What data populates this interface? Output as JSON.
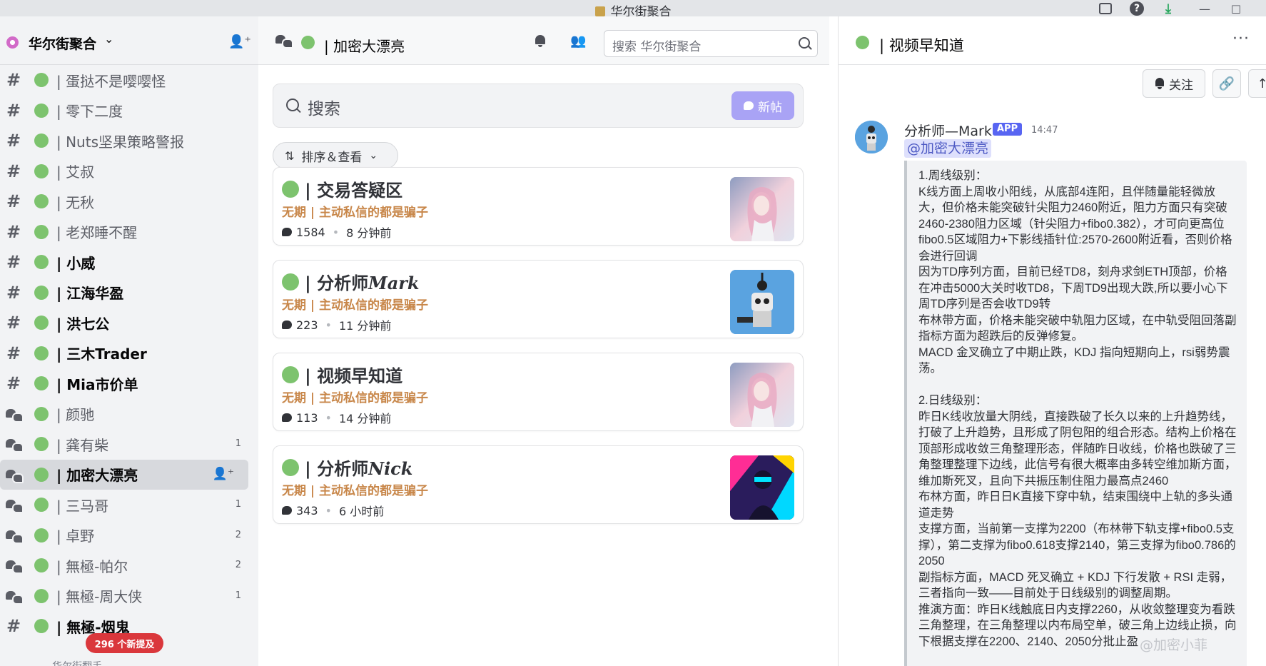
{
  "window": {
    "title": "华尔街聚合"
  },
  "sidebar": {
    "server_name": "华尔街聚合",
    "channels": [
      {
        "type": "text",
        "name": "| 蛋挞不是嘤嘤怪",
        "bold": false,
        "badge": ""
      },
      {
        "type": "text",
        "name": "| 零下二度",
        "bold": false,
        "badge": ""
      },
      {
        "type": "text",
        "name": "| Nuts坚果策略警报",
        "bold": false,
        "badge": ""
      },
      {
        "type": "text",
        "name": "| 艾叔",
        "bold": false,
        "badge": ""
      },
      {
        "type": "text",
        "name": "| 无秋",
        "bold": false,
        "badge": ""
      },
      {
        "type": "text",
        "name": "| 老郑睡不醒",
        "bold": false,
        "badge": ""
      },
      {
        "type": "text",
        "name": "| 小威",
        "bold": true,
        "badge": ""
      },
      {
        "type": "text",
        "name": "| 江海华盈",
        "bold": true,
        "badge": ""
      },
      {
        "type": "text",
        "name": "| 洪七公",
        "bold": true,
        "badge": ""
      },
      {
        "type": "text",
        "name": "| 三木Trader",
        "bold": true,
        "badge": ""
      },
      {
        "type": "text",
        "name": "| Mia市价单",
        "bold": true,
        "badge": ""
      },
      {
        "type": "forum",
        "name": "| 颜驰",
        "bold": false,
        "badge": ""
      },
      {
        "type": "forum",
        "name": "| 龚有柴",
        "bold": false,
        "badge": "1"
      },
      {
        "type": "forum",
        "name": "| 加密大漂亮",
        "bold": true,
        "badge": "",
        "active": true
      },
      {
        "type": "forum",
        "name": "| 三马哥",
        "bold": false,
        "badge": "1"
      },
      {
        "type": "forum",
        "name": "| 卓野",
        "bold": false,
        "badge": "2"
      },
      {
        "type": "forum",
        "name": "| 無極-帕尔",
        "bold": false,
        "badge": "2"
      },
      {
        "type": "forum",
        "name": "| 無極-周大侠",
        "bold": false,
        "badge": "1"
      },
      {
        "type": "text",
        "name": "| 無極-烟鬼",
        "bold": true,
        "badge": ""
      }
    ],
    "new_mentions": "296 个新提及",
    "bottom_category": "------------ 华尔街翻手 ------------"
  },
  "forum": {
    "title": "| 加密大漂亮",
    "search_placeholder": "搜索 华尔街聚合",
    "search_label": "搜索",
    "new_post_label": "新帖",
    "sort_label": "排序＆查看",
    "posts": [
      {
        "title_prefix": "| 交易答疑区",
        "title_italic": "",
        "tag": "无期 | 主动私信的都是骗子",
        "comments": "1584",
        "time": "8 分钟前",
        "thumb": "girl"
      },
      {
        "title_prefix": "| 分析师",
        "title_italic": "Mark",
        "tag": "无期 | 主动私信的都是骗子",
        "comments": "223",
        "time": "11 分钟前",
        "thumb": "robot"
      },
      {
        "title_prefix": "| 视频早知道",
        "title_italic": "",
        "tag": "无期 | 主动私信的都是骗子",
        "comments": "113",
        "time": "14 分钟前",
        "thumb": "girl"
      },
      {
        "title_prefix": "| 分析师",
        "title_italic": "Nick",
        "tag": "无期 | 主动私信的都是骗子",
        "comments": "343",
        "time": "6 小时前",
        "thumb": "neon"
      }
    ]
  },
  "thread": {
    "title": "| 视频早知道",
    "follow_label": "关注",
    "message": {
      "author": "分析师—Mark",
      "app_badge": "APP",
      "time": "14:47",
      "mention": "@加密大漂亮",
      "paragraphs": [
        "1.周线级别：",
        "K线方面上周收小阳线，从底部4连阳，且伴随量能轻微放大，但价格未能突破针尖阻力2460附近，阻力方面只有突破2460-2380阻力区域（针尖阻力+fibo0.382），才可向更高位fibo0.5区域阻力+下影线插针位:2570-2600附近看，否则价格会进行回调",
        "因为TD序列方面，目前已经TD8，刻舟求剑ETH顶部，价格在冲击5000大关时收TD8，下周TD9出现大跌,所以要小心下周TD序列是否会收TD9转",
        "布林带方面，价格未能突破中轨阻力区域，在中轨受阻回落副指标方面为超跌后的反弹修复。",
        "MACD 金叉确立了中期止跌，KDJ 指向短期向上，rsi弱势震荡。",
        "",
        "2.日线级别：",
        "昨日K线收放量大阴线，直接跌破了长久以来的上升趋势线，打破了上升趋势，且形成了阴包阳的组合形态。结构上价格在顶部形成收敛三角整理形态，伴随昨日收线，价格也跌破了三角整理整理下边线，此信号有很大概率由多转空维加斯方面，维加斯死叉，且向下共振压制住阻力最高点2460",
        "布林方面，昨日日K直接下穿中轨，结束围绕中上轨的多头通道走势",
        "支撑方面，当前第一支撑为2200（布林带下轨支撑+fibo0.5支撑），第二支撑为fibo0.618支撑2140，第三支撑为fibo0.786的2050",
        "副指标方面，MACD 死叉确立 + KDJ 下行发散 + RSI 走弱，三者指向一致——目前处于日线级别的调整周期。",
        "推演方面：昨日K线触底日内支撑2260，从收敛整理变为看跌三角整理，在三角整理以内布局空单，破三角上边线止损，向下根据支撑在2200、2140、2050分批止盈"
      ]
    },
    "watermark": "@加密小菲"
  },
  "colors": {
    "online_dot": "#7dc36e",
    "tag_orange": "#c8874a",
    "mention_badge": "#da373c",
    "app_badge": "#5865f2",
    "new_post": "#a9a3f5"
  },
  "icons": [
    "search-icon",
    "bell-icon",
    "members-icon",
    "add-member-icon",
    "forum-icon",
    "hash-icon",
    "comment-icon",
    "link-icon",
    "arrow-up-icon",
    "more-icon",
    "help-icon",
    "inbox-icon",
    "download-icon"
  ]
}
